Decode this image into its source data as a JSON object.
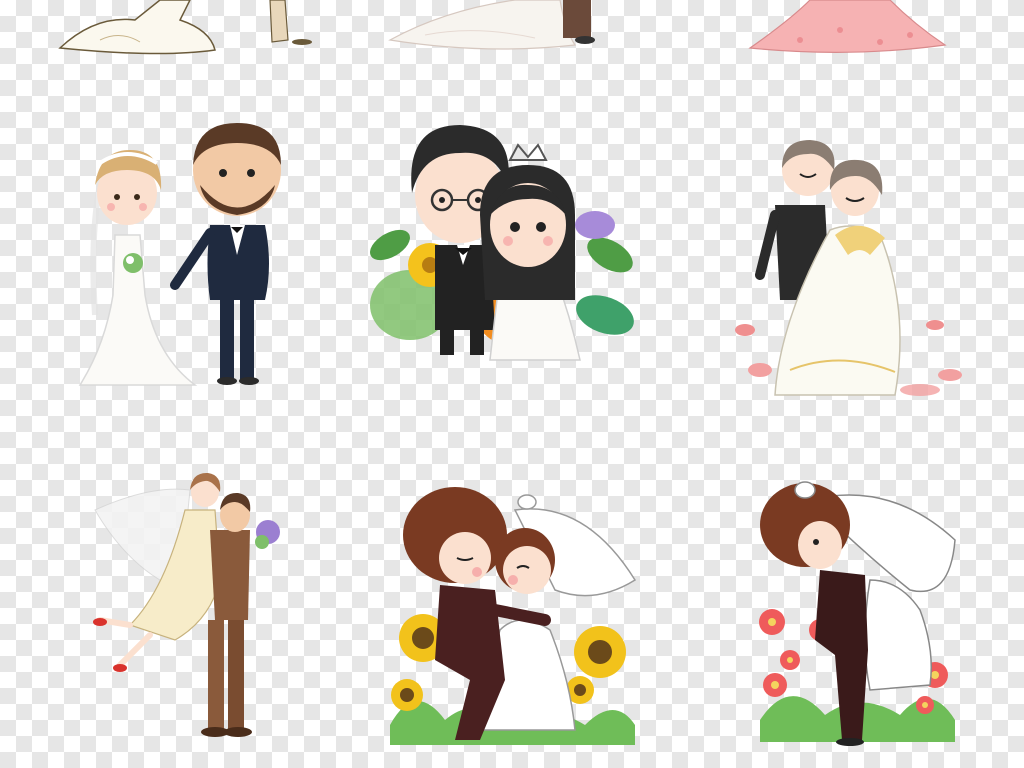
{
  "image": {
    "background": "transparency-checkerboard",
    "cards": [
      {
        "id": "top-left-dress-partial"
      },
      {
        "id": "top-middle-gown-partial"
      },
      {
        "id": "top-right-pink-gown-partial"
      },
      {
        "id": "bearded-groom-and-bride"
      },
      {
        "id": "glasses-groom-and-bride-flowers"
      },
      {
        "id": "anime-couple-petals"
      },
      {
        "id": "groom-lifting-bride"
      },
      {
        "id": "kissing-couple-sunflowers"
      },
      {
        "id": "hugging-couple-red-flowers"
      }
    ]
  },
  "colors": {
    "checker_light": "#ffffff",
    "checker_dark": "#e6e6e6",
    "suit_navy": "#1f2a3f",
    "suit_black": "#2b2b2b",
    "suit_brown": "#8a5a3b",
    "hair_brown": "#7a3a22",
    "gown_white": "#fbfaf7",
    "gown_pink": "#f6b2b3",
    "skin": "#fbe0cf",
    "leaf_green": "#6fbd58",
    "sunflower": "#f2c21b",
    "red_flower": "#ef5b5b"
  }
}
